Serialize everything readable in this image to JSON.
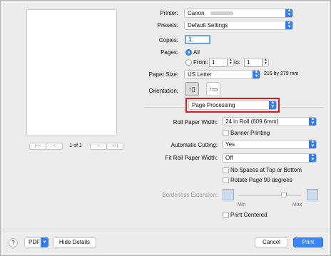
{
  "printer": {
    "label": "Printer:",
    "value": "Canon"
  },
  "presets": {
    "label": "Presets:",
    "value": "Default Settings"
  },
  "copies": {
    "label": "Copies:",
    "value": "1"
  },
  "pages": {
    "label": "Pages:",
    "all_label": "All",
    "from_label": "From:",
    "from_value": "1",
    "to_label": "to:",
    "to_value": "1"
  },
  "paper_size": {
    "label": "Paper Size:",
    "value": "US Letter",
    "dimensions": "216 by 279 mm"
  },
  "orientation": {
    "label": "Orientation:"
  },
  "section_menu": {
    "value": "Page Processing"
  },
  "roll_paper_width": {
    "label": "Roll Paper Width:",
    "value": "24 in Roll (609.6mm)"
  },
  "banner_printing": {
    "label": "Banner Printing"
  },
  "automatic_cutting": {
    "label": "Automatic Cutting:",
    "value": "Yes"
  },
  "fit_roll_paper_width": {
    "label": "Fit Roll Paper Width:",
    "value": "Off"
  },
  "no_spaces": {
    "label": "No Spaces at Top or Bottom"
  },
  "rotate_90": {
    "label": "Rotate Page 90 degrees"
  },
  "borderless_extension": {
    "label": "Borderless Extension:",
    "min_label": "Min",
    "max_label": "Max",
    "level": 0.75
  },
  "print_centered": {
    "label": "Print Centered"
  },
  "preview": {
    "page_indicator": "1 of 1"
  },
  "footer": {
    "help": "?",
    "pdf": "PDF",
    "hide_details": "Hide Details",
    "cancel": "Cancel",
    "print": "Print"
  }
}
